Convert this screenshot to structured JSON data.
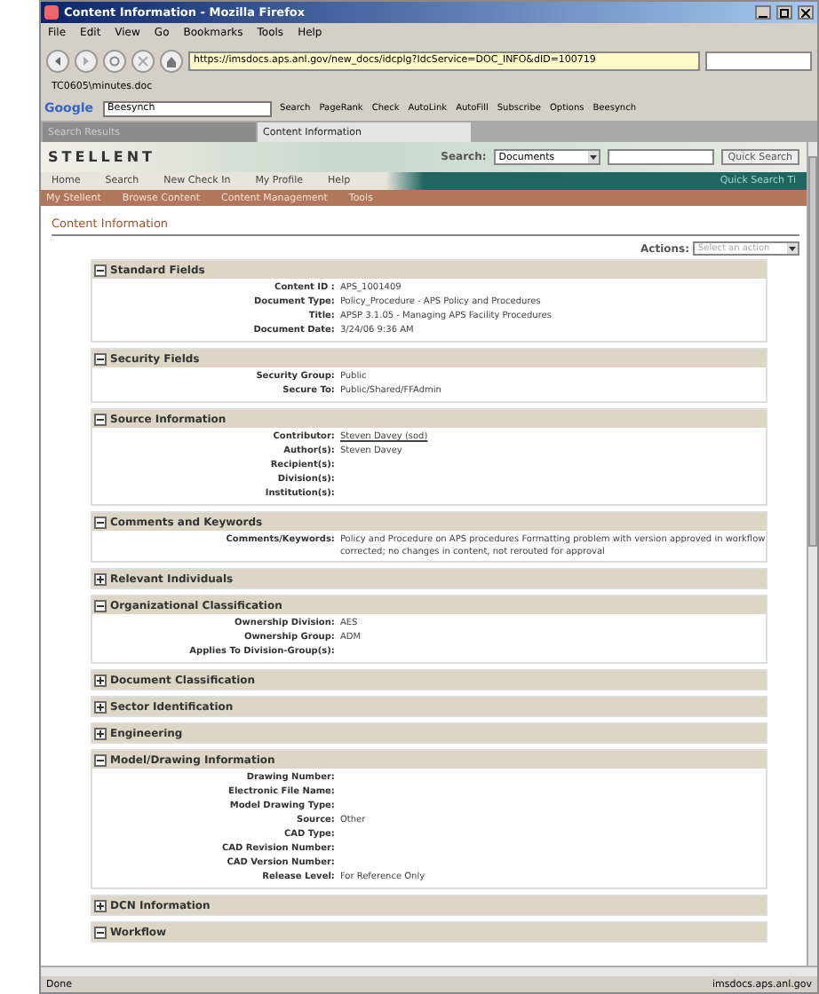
{
  "window": {
    "title": "Content Information - Mozilla Firefox"
  },
  "menu": [
    "File",
    "Edit",
    "View",
    "Go",
    "Bookmarks",
    "Tools",
    "Help"
  ],
  "address": "https://imsdocs.aps.anl.gov/new_docs/idcplg?IdcService=DOC_INFO&dID=100719",
  "bookmark": "TC0605\\minutes.doc",
  "google_toolbar": {
    "logo": "Google",
    "query": "Beesynch",
    "items": [
      "Search",
      "PageRank",
      "Check",
      "AutoLink",
      "AutoFill",
      "Subscribe",
      "Options",
      "Beesynch"
    ]
  },
  "tabs": [
    {
      "label": "Search Results",
      "selected": false
    },
    {
      "label": "Content Information",
      "selected": true
    }
  ],
  "header": {
    "logo": "STELLENT",
    "search_label": "Search:",
    "search_scope": "Documents",
    "button": "Quick Search"
  },
  "nav": [
    "Home",
    "Search",
    "New Check In",
    "My Profile",
    "Help"
  ],
  "nav_right": "Quick Search Ti",
  "tray": [
    "My Stellent",
    "Browse Content",
    "Content Management",
    "Tools"
  ],
  "page_title": "Content Information",
  "actions": {
    "label": "Actions:",
    "placeholder": "Select an action"
  },
  "sections": [
    {
      "title": "Standard Fields",
      "expanded": true,
      "fields": [
        {
          "label": "Content ID :",
          "value": "APS_1001409"
        },
        {
          "label": "Document Type:",
          "value": "Policy_Procedure - APS Policy and Procedures"
        },
        {
          "label": "Title:",
          "value": "APSP 3.1.05 - Managing APS Facility Procedures"
        },
        {
          "label": "Document Date:",
          "value": "3/24/06 9:36 AM"
        }
      ]
    },
    {
      "title": "Security Fields",
      "expanded": true,
      "fields": [
        {
          "label": "Security Group:",
          "value": "Public"
        },
        {
          "label": "Secure To:",
          "value": "Public/Shared/FFAdmin"
        }
      ]
    },
    {
      "title": "Source Information",
      "expanded": true,
      "fields": [
        {
          "label": "Contributor:",
          "value": "Steven Davey (sod)",
          "link": true
        },
        {
          "label": "Author(s):",
          "value": "Steven Davey"
        },
        {
          "label": "Recipient(s):"
        },
        {
          "label": "Division(s):"
        },
        {
          "label": "Institution(s):"
        }
      ]
    },
    {
      "title": "Comments and Keywords",
      "expanded": true,
      "fields": [
        {
          "label": "Comments/Keywords:",
          "value": "Policy and Procedure on APS procedures Formatting problem with version approved in workflow corrected; no changes in content, not rerouted for approval"
        }
      ]
    },
    {
      "title": "Relevant Individuals",
      "expanded": false
    },
    {
      "title": "Organizational Classification",
      "expanded": true,
      "fields": [
        {
          "label": "Ownership Division:",
          "value": "AES"
        },
        {
          "label": "Ownership Group:",
          "value": "ADM"
        },
        {
          "label": "Applies To Division-Group(s):"
        }
      ]
    },
    {
      "title": "Document Classification",
      "expanded": false
    },
    {
      "title": "Sector Identification",
      "expanded": false
    },
    {
      "title": "Engineering",
      "expanded": false
    },
    {
      "title": "Model/Drawing Information",
      "expanded": true,
      "fields": [
        {
          "label": "Drawing Number:"
        },
        {
          "label": "Electronic File Name:"
        },
        {
          "label": "Model Drawing Type:"
        },
        {
          "label": "Source:",
          "value": "Other"
        },
        {
          "label": "CAD Type:"
        },
        {
          "label": "CAD Revision Number:"
        },
        {
          "label": "CAD Version Number:"
        },
        {
          "label": "Release Level:",
          "value": "For Reference Only"
        }
      ]
    },
    {
      "title": "DCN Information",
      "expanded": false
    },
    {
      "title": "Workflow",
      "expanded": true
    }
  ],
  "status": {
    "text": "Done",
    "host": "imsdocs.aps.anl.gov"
  }
}
